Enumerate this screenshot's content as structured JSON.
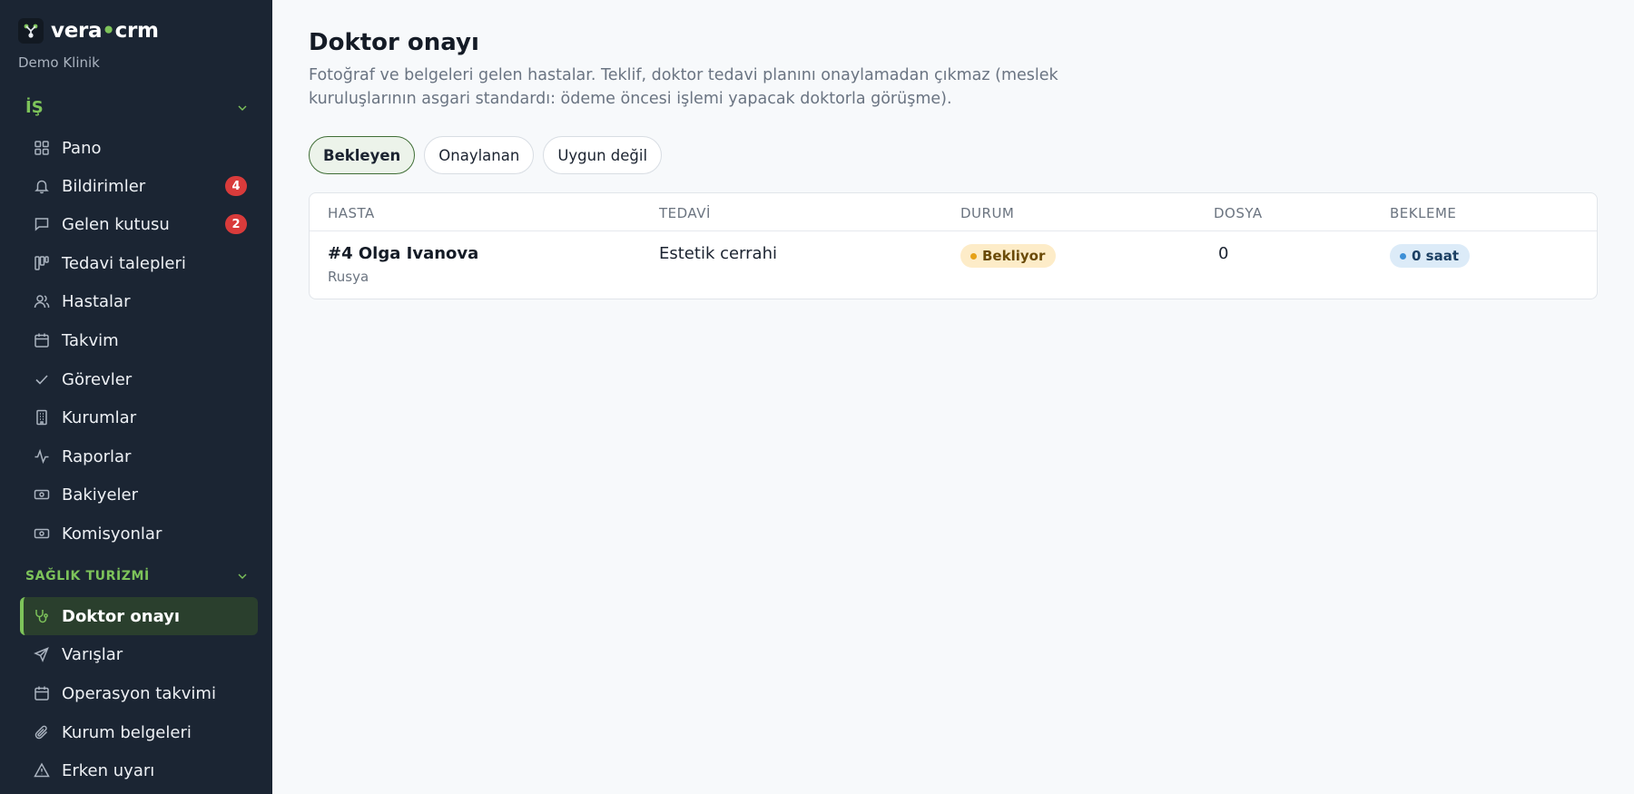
{
  "brand": {
    "name_left": "vera",
    "name_dot": "•",
    "name_right": "crm",
    "org": "Demo Klinik"
  },
  "sidebar": {
    "section_business": "İŞ",
    "business_items": [
      {
        "label": "Pano",
        "icon": "grid-icon"
      },
      {
        "label": "Bildirimler",
        "icon": "bell-icon",
        "badge": "4"
      },
      {
        "label": "Gelen kutusu",
        "icon": "message-icon",
        "badge": "2"
      },
      {
        "label": "Tedavi talepleri",
        "icon": "kanban-icon"
      },
      {
        "label": "Hastalar",
        "icon": "users-icon"
      },
      {
        "label": "Takvim",
        "icon": "calendar-icon"
      },
      {
        "label": "Görevler",
        "icon": "check-icon"
      },
      {
        "label": "Kurumlar",
        "icon": "building-icon"
      },
      {
        "label": "Raporlar",
        "icon": "activity-icon"
      },
      {
        "label": "Bakiyeler",
        "icon": "banknote-icon"
      },
      {
        "label": "Komisyonlar",
        "icon": "banknote-icon"
      }
    ],
    "section_health": "SAĞLIK TURİZMİ",
    "health_items": [
      {
        "label": "Doktor onayı",
        "icon": "stethoscope-icon",
        "active": true
      },
      {
        "label": "Varışlar",
        "icon": "plane-icon"
      },
      {
        "label": "Operasyon takvimi",
        "icon": "calendar-icon"
      },
      {
        "label": "Kurum belgeleri",
        "icon": "paperclip-icon"
      },
      {
        "label": "Erken uyarı",
        "icon": "warning-icon"
      }
    ]
  },
  "main": {
    "title": "Doktor onayı",
    "description": "Fotoğraf ve belgeleri gelen hastalar. Teklif, doktor tedavi planını onaylamadan çıkmaz (meslek kuruluşlarının asgari standardı: ödeme öncesi işlemi yapacak doktorla görüşme).",
    "tabs": [
      {
        "label": "Bekleyen",
        "active": true
      },
      {
        "label": "Onaylanan"
      },
      {
        "label": "Uygun değil"
      }
    ],
    "table": {
      "columns": [
        "HASTA",
        "TEDAVİ",
        "DURUM",
        "DOSYA",
        "BEKLEME"
      ],
      "rows": [
        {
          "patient": "#4 Olga Ivanova",
          "country": "Rusya",
          "treatment": "Estetik cerrahi",
          "status": "Bekliyor",
          "files": "0",
          "waiting": "0 saat"
        }
      ]
    }
  },
  "colors": {
    "accent": "#7dc35a",
    "sidebar_bg": "#1b2533",
    "badge": "#d93b3b",
    "status_pending": "#e6a117",
    "waiting_dot": "#3d8fd6"
  }
}
